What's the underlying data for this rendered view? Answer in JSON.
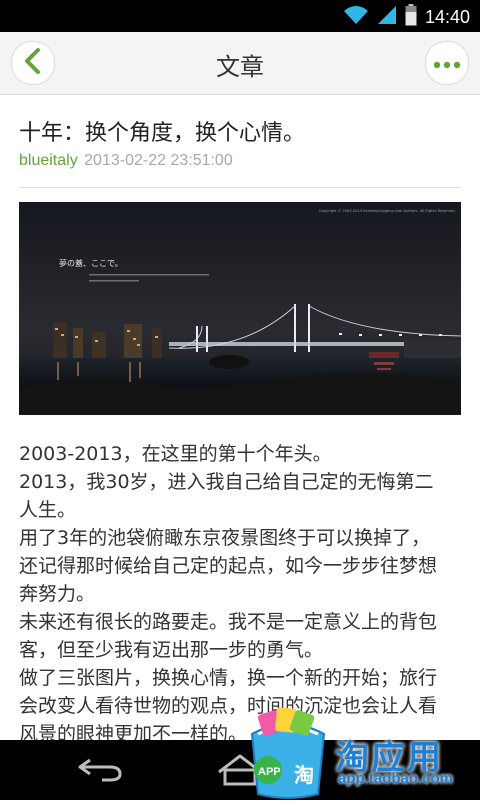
{
  "status_bar": {
    "time": "14:40",
    "icons": [
      "wifi-icon",
      "signal-icon",
      "battery-icon"
    ]
  },
  "app_bar": {
    "title": "文章",
    "left_icon": "chevron-left-icon",
    "right_icon": "more-dots-icon"
  },
  "article": {
    "title": "十年：换个角度，换个心情。",
    "author": "blueitaly",
    "date": "2013-02-22 23:51:00",
    "image": {
      "caption": "夢の蓋、ここで。",
      "copyright_text": "Copyright © 2003-2013 blueitaly.blogbus.com Authors. All Rights Reserved."
    },
    "lines": [
      "2003-2013，在这里的第十个年头。",
      "2013，我30岁，进入我自己给自己定的无悔第二",
      "人生。",
      "用了3年的池袋俯瞰东京夜景图终于可以换掉了，",
      "还记得那时候给自己定的起点，如今一步步往梦想",
      "奔努力。",
      "未来还有很长的路要走。我不是一定意义上的背包",
      "客，但至少我有迈出那一步的勇气。",
      "做了三张图片，换换心情，换一个新的开始；旅行",
      "会改变人看待世物的观点，时间的沉淀也会让人看",
      "风景的眼神更加不一样的。"
    ]
  },
  "nav_bar": {
    "icons": [
      "back-arrow-icon",
      "home-icon"
    ]
  },
  "watermark": {
    "brand": "淘应用",
    "url": "app.taobao.com",
    "badge": "APP",
    "bag_char": "淘"
  },
  "colors": {
    "accent_green": "#63a43a",
    "date_gray": "#a8a8a8",
    "watermark_blue": "#1e7fd4"
  }
}
